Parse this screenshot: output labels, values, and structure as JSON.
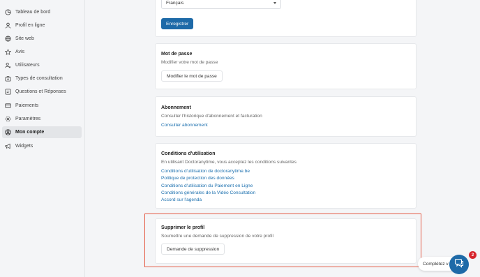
{
  "sidebar": {
    "items": [
      {
        "label": "Tableau de bord",
        "icon": "dashboard-icon"
      },
      {
        "label": "Profil en ligne",
        "icon": "user-icon"
      },
      {
        "label": "Site web",
        "icon": "globe-icon"
      },
      {
        "label": "Avis",
        "icon": "star-icon"
      },
      {
        "label": "Utilisateurs",
        "icon": "users-icon"
      },
      {
        "label": "Types de consultation",
        "icon": "medical-bag-icon"
      },
      {
        "label": "Questions et Réponses",
        "icon": "qa-icon"
      },
      {
        "label": "Paiements",
        "icon": "credit-card-icon"
      },
      {
        "label": "Paramètres",
        "icon": "gear-icon"
      },
      {
        "label": "Mon compte",
        "icon": "account-circle-icon",
        "active": true
      },
      {
        "label": "Widgets",
        "icon": "megaphone-icon"
      }
    ]
  },
  "language": {
    "selected": "Français",
    "save_label": "Enregistrer"
  },
  "password": {
    "title": "Mot de passe",
    "subtitle": "Modifier votre mot de passe",
    "button": "Modifier le mot de passe"
  },
  "subscription": {
    "title": "Abonnement",
    "subtitle": "Consulter l'historique d'abonnement et facturation",
    "link": "Consulter abonnement"
  },
  "terms": {
    "title": "Conditions d'utilisation",
    "subtitle": "En utilisant Doctoranytime, vous acceptez les conditions suivantes",
    "links": [
      "Conditions d'utilisation de doctoranytime.be",
      "Politique de protection des données",
      "Conditions d'utilisation du Paiement en Ligne",
      "Conditions générales de la Vidéo Consultation",
      "Accord sur l'agenda"
    ]
  },
  "delete_profile": {
    "title": "Supprimer le profil",
    "subtitle": "Soumettre une demande de suppression de votre profil",
    "button": "Demande de suppression"
  },
  "chat": {
    "pill_text": "Complétez v",
    "badge_count": "2"
  },
  "colors": {
    "accent": "#1e6aa8",
    "link": "#1b6fae",
    "highlight": "#e45b45",
    "badge": "#d7262e"
  }
}
